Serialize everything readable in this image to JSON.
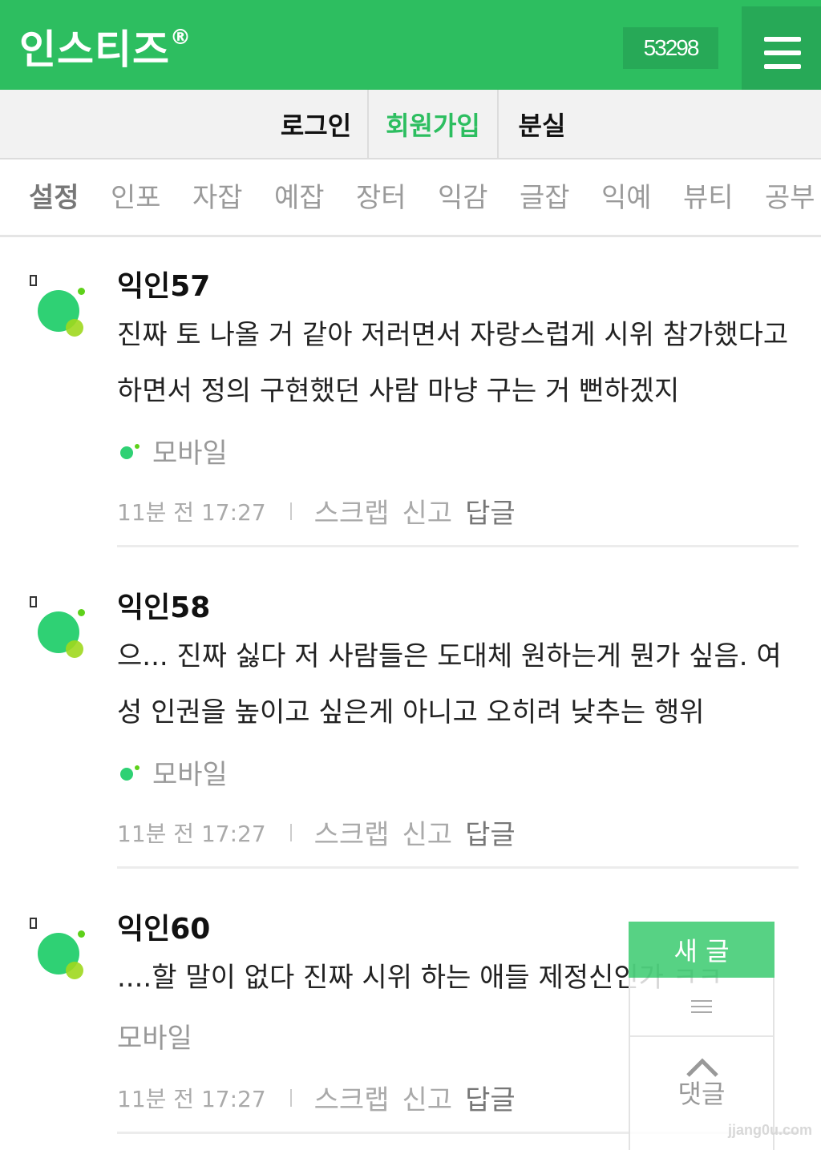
{
  "header": {
    "logo": "인스티즈",
    "logo_mark": "®",
    "visitor_count": "53298",
    "menu_icon": "hamburger-icon"
  },
  "authbar": {
    "login": "로그인",
    "signup": "회원가입",
    "lost": "분실",
    "signup_color": "#2dbe60"
  },
  "tabs": [
    "설정",
    "인포",
    "자잡",
    "예잡",
    "장터",
    "익감",
    "글잡",
    "익예",
    "뷰티",
    "공부"
  ],
  "comments": [
    {
      "author": "익인57",
      "text": "진짜 토 나올 거 같아 저러면서 자랑스럽게 시위 참가했다고 하면서 정의 구현했던 사람 마냥 구는 거 뻔하겠지",
      "device": "모바일",
      "time": "11분 전 17:27",
      "scrap": "스크랩",
      "report": "신고",
      "reply": "답글"
    },
    {
      "author": "익인58",
      "text": "으... 진짜 싫다 저 사람들은 도대체 원하는게 뭔가 싶음. 여성 인권을 높이고 싶은게 아니고 오히려 낮추는 행위",
      "device": "모바일",
      "time": "11분 전 17:27",
      "scrap": "스크랩",
      "report": "신고",
      "reply": "답글"
    },
    {
      "author": "익인60",
      "text": "....할 말이 없다 진짜 시위 하는 애들 제정신인가 ㅋㅋ",
      "device": "모바일",
      "time": "11분 전 17:27",
      "scrap": "스크랩",
      "report": "신고",
      "reply": "답글"
    }
  ],
  "floating": {
    "new_post": "새 글",
    "list_icon": "list-icon",
    "up_icon": "chevron-up-icon",
    "comments": "댓글"
  },
  "watermark": "jjang0u.com",
  "colors": {
    "brand_green": "#2dbe60",
    "avatar_green": "#2fd174",
    "avatar_lime": "#9ed81e"
  }
}
